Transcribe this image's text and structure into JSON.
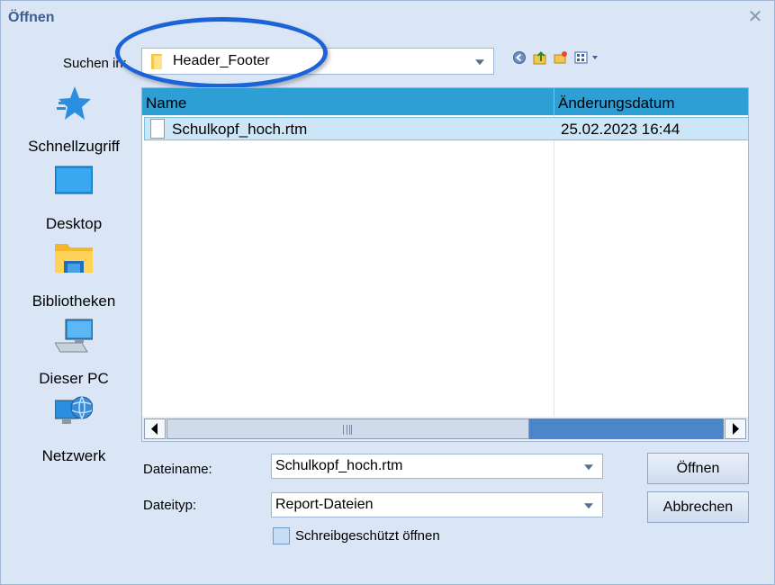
{
  "window": {
    "title": "Öffnen",
    "close_icon": "close-icon"
  },
  "lookin": {
    "label": "Suchen in:",
    "value": "Header_Footer",
    "folder_icon": "folder-icon"
  },
  "toolbar": {
    "icons": [
      "back-icon",
      "up-folder-icon",
      "new-folder-icon",
      "view-menu-icon"
    ]
  },
  "places": [
    {
      "label": "Schnellzugriff",
      "icon": "star-icon"
    },
    {
      "label": "Desktop",
      "icon": "desktop-icon"
    },
    {
      "label": "Bibliotheken",
      "icon": "library-folder-icon"
    },
    {
      "label": "Dieser PC",
      "icon": "computer-icon"
    },
    {
      "label": "Netzwerk",
      "icon": "network-icon"
    }
  ],
  "filelist": {
    "columns": [
      "Name",
      "Änderungsdatum"
    ],
    "rows": [
      {
        "name": "Schulkopf_hoch.rtm",
        "date": "25.02.2023 16:44",
        "icon": "file-icon"
      }
    ]
  },
  "form": {
    "filename_label": "Dateiname:",
    "filename_value": "Schulkopf_hoch.rtm",
    "filetype_label": "Dateityp:",
    "filetype_value": "Report-Dateien",
    "readonly_label": "Schreibgeschützt öffnen",
    "open_button": "Öffnen",
    "cancel_button": "Abbrechen"
  },
  "colors": {
    "accent": "#2e9fd5",
    "highlight_ellipse": "#1b63d6",
    "background": "#dae6f5"
  }
}
